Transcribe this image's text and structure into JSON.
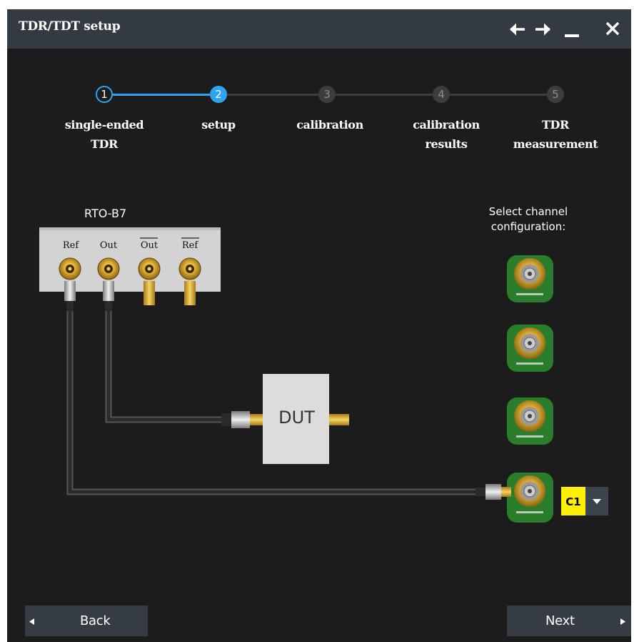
{
  "window": {
    "title": "TDR/TDT setup",
    "controls": [
      "arrow-left-icon",
      "arrow-right-icon",
      "minimize-icon",
      "close-icon"
    ]
  },
  "wizard": {
    "steps": [
      {
        "number": "1",
        "label": "single-ended\nTDR",
        "state": "done"
      },
      {
        "number": "2",
        "label": "setup",
        "state": "active"
      },
      {
        "number": "3",
        "label": "calibration",
        "state": "pending"
      },
      {
        "number": "4",
        "label": "calibration\nresults",
        "state": "pending"
      },
      {
        "number": "5",
        "label": "TDR\nmeasurement",
        "state": "pending"
      }
    ]
  },
  "diagram": {
    "module_name": "RTO-B7",
    "ports": [
      "Ref",
      "Out",
      "Out",
      "Ref"
    ],
    "dut_label": "DUT",
    "channel_prompt": "Select channel\nconfiguration:",
    "selected_channel": "C1"
  },
  "nav": {
    "back": "Back",
    "next": "Next"
  },
  "colors": {
    "background": "#1c1c1c",
    "titlebar": "#333a42",
    "accent": "#2da4f0",
    "channel_highlight": "#ffef00"
  }
}
